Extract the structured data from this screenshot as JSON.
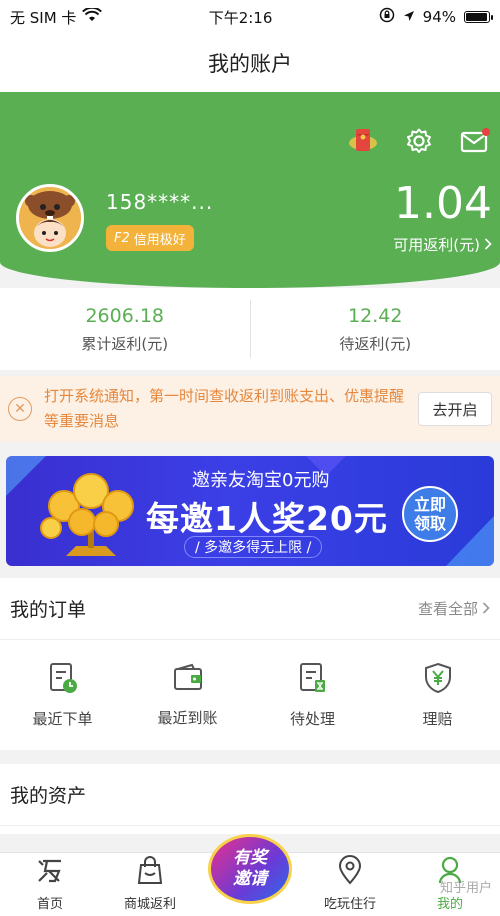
{
  "status_bar": {
    "carrier": "无 SIM 卡",
    "time": "下午2:16",
    "battery_percent": "94%",
    "battery_level": 0.94
  },
  "nav": {
    "title": "我的账户"
  },
  "header": {
    "username": "158****...",
    "credit_level": "F2",
    "credit_text": "信用极好",
    "balance": "1.04",
    "balance_label": "可用返利(元)",
    "accent_color": "#5aaf53"
  },
  "stats": [
    {
      "value": "2606.18",
      "label": "累计返利(元)"
    },
    {
      "value": "12.42",
      "label": "待返利(元)"
    }
  ],
  "notice": {
    "text": "打开系统通知，第一时间查收返利到账支出、优惠提醒等重要消息",
    "button": "去开启"
  },
  "banner": {
    "title": "邀亲友淘宝0元购",
    "headline": "每邀1人奖20元",
    "subline": "/ 多邀多得无上限 /",
    "cta": "立即领取"
  },
  "orders": {
    "title": "我的订单",
    "more": "查看全部",
    "items": [
      {
        "label": "最近下单",
        "icon": "order-clock-icon"
      },
      {
        "label": "最近到账",
        "icon": "wallet-icon"
      },
      {
        "label": "待处理",
        "icon": "pending-doc-icon"
      },
      {
        "label": "理赔",
        "icon": "shield-yen-icon"
      }
    ]
  },
  "assets": {
    "title": "我的资产"
  },
  "tabbar": {
    "tabs": [
      {
        "label": "首页",
        "icon": "home-fan-icon"
      },
      {
        "label": "商城返利",
        "icon": "shopping-bag-icon"
      },
      {
        "label": "",
        "icon": "invite-icon"
      },
      {
        "label": "吃玩住行",
        "icon": "location-pin-icon"
      },
      {
        "label": "我的",
        "icon": "profile-icon"
      }
    ],
    "invite_label": "有奖邀请"
  },
  "watermark": "知乎用户"
}
